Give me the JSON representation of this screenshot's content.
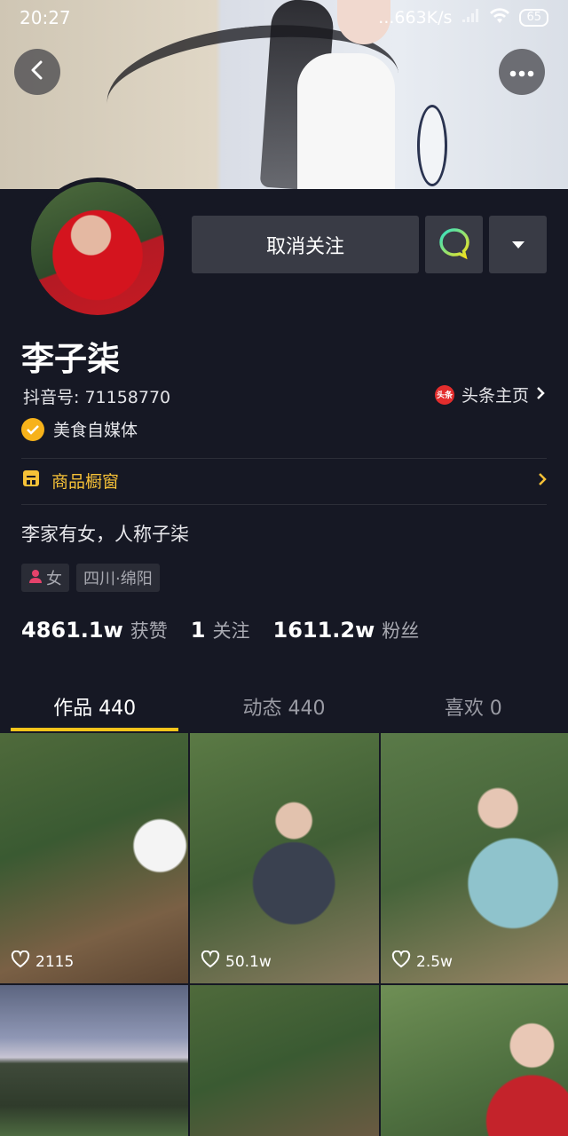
{
  "status_bar": {
    "time": "20:27",
    "network_speed": "...663K/s",
    "battery": "65"
  },
  "profile": {
    "name": "李子柒",
    "douyin_id": "抖音号: 71158770",
    "toutiao_link": "头条主页",
    "toutiao_logo": "头条",
    "verification": "美食自媒体",
    "shop_window": "商品橱窗",
    "bio": "李家有女，人称子柒",
    "tags": {
      "gender": "女",
      "location": "四川·绵阳"
    }
  },
  "actions": {
    "unfollow_label": "取消关注"
  },
  "stats": {
    "likes_num": "4861.1w",
    "likes_label": "获赞",
    "following_num": "1",
    "following_label": "关注",
    "followers_num": "1611.2w",
    "followers_label": "粉丝"
  },
  "tabs": [
    {
      "label": "作品 440",
      "active": true
    },
    {
      "label": "动态 440",
      "active": false
    },
    {
      "label": "喜欢 0",
      "active": false
    }
  ],
  "videos": [
    {
      "likes": "2115"
    },
    {
      "likes": "50.1w"
    },
    {
      "likes": "2.5w"
    }
  ],
  "colors": {
    "background": "#161824",
    "accent_yellow": "#f7c41b",
    "verified_badge": "#f7b21a",
    "chat_icon_gradient": [
      "#2fe1c6",
      "#f7e21b"
    ]
  }
}
